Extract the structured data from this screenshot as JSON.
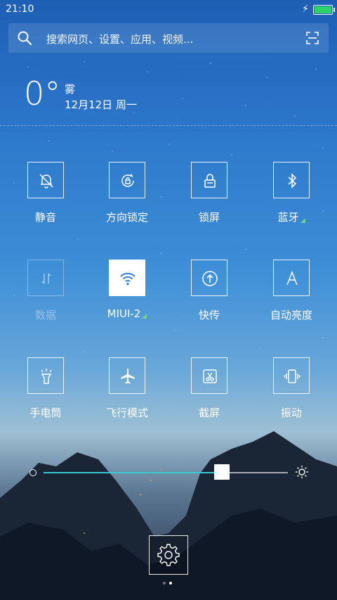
{
  "status": {
    "time": "21:10",
    "battery_color": "#2bd36b"
  },
  "search": {
    "placeholder": "搜索网页、设置、应用、视频..."
  },
  "weather": {
    "temp": "0°",
    "condition": "雾",
    "date": "12月12日 周一"
  },
  "tiles": [
    {
      "label": "静音",
      "icon": "bell-off-icon"
    },
    {
      "label": "方向锁定",
      "icon": "rotation-lock-icon"
    },
    {
      "label": "锁屏",
      "icon": "lock-icon"
    },
    {
      "label": "蓝牙",
      "icon": "bluetooth-icon"
    },
    {
      "label": "数据",
      "icon": "mobile-data-icon",
      "state": "disabled"
    },
    {
      "label": "MIUI-2",
      "icon": "wifi-icon",
      "state": "on"
    },
    {
      "label": "快传",
      "icon": "share-upload-icon"
    },
    {
      "label": "自动亮度",
      "icon": "auto-brightness-icon"
    },
    {
      "label": "手电筒",
      "icon": "flashlight-icon"
    },
    {
      "label": "飞行模式",
      "icon": "airplane-icon"
    },
    {
      "label": "截屏",
      "icon": "screenshot-icon"
    },
    {
      "label": "振动",
      "icon": "vibrate-icon"
    }
  ],
  "brightness": {
    "level": 0.73,
    "accent": "#39c9d4"
  },
  "pager": {
    "pages": 2,
    "current": 2
  }
}
